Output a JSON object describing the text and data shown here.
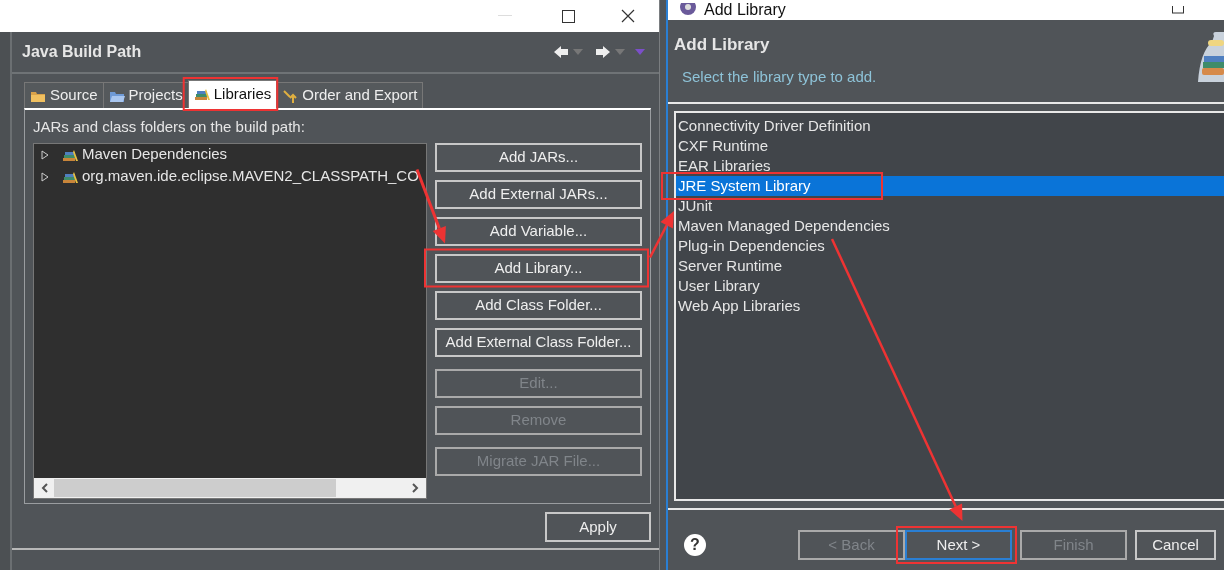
{
  "build_path_window": {
    "title": "Java Build Path",
    "tabs": [
      {
        "label": "Source",
        "kind": "source",
        "selected": false,
        "highlighted": false
      },
      {
        "label": "Projects",
        "kind": "projects",
        "selected": false,
        "highlighted": false
      },
      {
        "label": "Libraries",
        "kind": "libraries",
        "selected": true,
        "highlighted": true
      },
      {
        "label": "Order and Export",
        "kind": "order",
        "selected": false,
        "highlighted": false
      }
    ],
    "list_label": "JARs and class folders on the build path:",
    "tree": [
      {
        "label": "Maven Dependencies",
        "expanded": false
      },
      {
        "label": "org.maven.ide.eclipse.MAVEN2_CLASSPATH_CO",
        "expanded": false
      }
    ],
    "button_groups": [
      [
        {
          "label": "Add JARs...",
          "disabled": false,
          "highlighted": false
        },
        {
          "label": "Add External JARs...",
          "disabled": false,
          "highlighted": false
        },
        {
          "label": "Add Variable...",
          "disabled": false,
          "highlighted": false
        },
        {
          "label": "Add Library...",
          "disabled": false,
          "highlighted": true
        },
        {
          "label": "Add Class Folder...",
          "disabled": false,
          "highlighted": false
        },
        {
          "label": "Add External Class Folder...",
          "disabled": false,
          "highlighted": false
        }
      ],
      [
        {
          "label": "Edit...",
          "disabled": true,
          "highlighted": false
        },
        {
          "label": "Remove",
          "disabled": true,
          "highlighted": false
        }
      ],
      [
        {
          "label": "Migrate JAR File...",
          "disabled": true,
          "highlighted": false
        }
      ]
    ],
    "apply_button": "Apply"
  },
  "add_library_dialog": {
    "window_title": "Add Library",
    "title": "Add Library",
    "subtitle": "Select the library type to add.",
    "items": [
      {
        "label": "Connectivity Driver Definition",
        "selected": false,
        "highlighted": false
      },
      {
        "label": "CXF Runtime",
        "selected": false,
        "highlighted": false
      },
      {
        "label": "EAR Libraries",
        "selected": false,
        "highlighted": false
      },
      {
        "label": "JRE System Library",
        "selected": true,
        "highlighted": true
      },
      {
        "label": "JUnit",
        "selected": false,
        "highlighted": false
      },
      {
        "label": "Maven Managed Dependencies",
        "selected": false,
        "highlighted": false
      },
      {
        "label": "Plug-in Dependencies",
        "selected": false,
        "highlighted": false
      },
      {
        "label": "Server Runtime",
        "selected": false,
        "highlighted": false
      },
      {
        "label": "User Library",
        "selected": false,
        "highlighted": false
      },
      {
        "label": "Web App Libraries",
        "selected": false,
        "highlighted": false
      }
    ],
    "help_icon": "?",
    "buttons": [
      {
        "label": "< Back",
        "disabled": true,
        "default": false,
        "highlighted": false
      },
      {
        "label": "Next >",
        "disabled": false,
        "default": true,
        "highlighted": true
      },
      {
        "label": "Finish",
        "disabled": true,
        "default": false,
        "highlighted": false
      },
      {
        "label": "Cancel",
        "disabled": false,
        "default": false,
        "highlighted": false
      }
    ]
  }
}
